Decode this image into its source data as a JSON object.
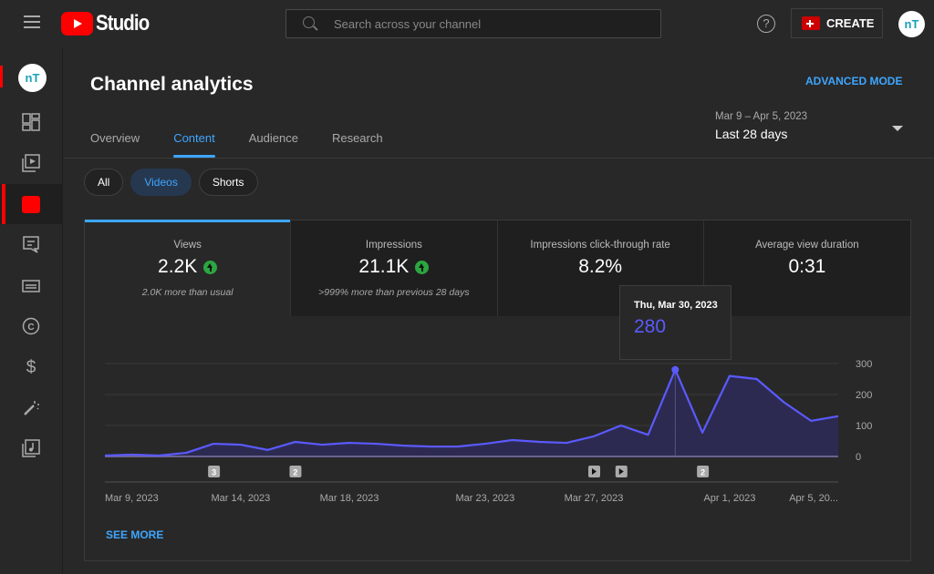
{
  "topbar": {
    "logo_text": "Studio",
    "search_placeholder": "Search across your channel",
    "help_label": "?",
    "create_label": "CREATE",
    "avatar_initials": "nT"
  },
  "sidebar": {
    "avatar_initials": "nT",
    "items": [
      {
        "name": "dashboard",
        "icon": "dashboard-icon"
      },
      {
        "name": "content",
        "icon": "content-icon"
      },
      {
        "name": "analytics",
        "icon": "analytics-icon",
        "active": true
      },
      {
        "name": "comments",
        "icon": "comments-icon"
      },
      {
        "name": "subtitles",
        "icon": "subtitles-icon"
      },
      {
        "name": "copyright",
        "icon": "copyright-icon"
      },
      {
        "name": "earn",
        "icon": "dollar-icon"
      },
      {
        "name": "customization",
        "icon": "magic-wand-icon"
      },
      {
        "name": "audio-library",
        "icon": "audio-library-icon"
      }
    ]
  },
  "main": {
    "title": "Channel analytics",
    "advanced_mode": "ADVANCED MODE",
    "tabs": [
      {
        "label": "Overview"
      },
      {
        "label": "Content",
        "active": true
      },
      {
        "label": "Audience"
      },
      {
        "label": "Research"
      }
    ],
    "date_range": {
      "sub": "Mar 9 – Apr 5, 2023",
      "main": "Last 28 days"
    },
    "chips": [
      {
        "label": "All"
      },
      {
        "label": "Videos",
        "active": true
      },
      {
        "label": "Shorts"
      }
    ],
    "metrics": [
      {
        "label": "Views",
        "value": "2.2K",
        "trend": "up",
        "sub": "2.0K more than usual"
      },
      {
        "label": "Impressions",
        "value": "21.1K",
        "trend": "up",
        "sub": ">999% more than previous 28 days"
      },
      {
        "label": "Impressions click-through rate",
        "value": "8.2%",
        "sub": ""
      },
      {
        "label": "Average view duration",
        "value": "0:31",
        "sub": ""
      }
    ],
    "tooltip": {
      "date": "Thu, Mar 30, 2023",
      "value": "280"
    },
    "see_more": "SEE MORE"
  },
  "colors": {
    "accent": "#3ea6ff",
    "line": "#5a5aff",
    "brand_red": "#ff0000",
    "trend_up": "#2ba640"
  },
  "chart_data": {
    "type": "area",
    "title": "Views",
    "x": [
      "Mar 9",
      "Mar 10",
      "Mar 11",
      "Mar 12",
      "Mar 13",
      "Mar 14",
      "Mar 15",
      "Mar 16",
      "Mar 17",
      "Mar 18",
      "Mar 19",
      "Mar 20",
      "Mar 21",
      "Mar 22",
      "Mar 23",
      "Mar 24",
      "Mar 25",
      "Mar 26",
      "Mar 27",
      "Mar 28",
      "Mar 29",
      "Mar 30",
      "Mar 31",
      "Apr 1",
      "Apr 2",
      "Apr 3",
      "Apr 4",
      "Apr 5"
    ],
    "series": [
      {
        "name": "Views",
        "values": [
          3,
          6,
          3,
          12,
          41,
          38,
          21,
          47,
          38,
          44,
          41,
          35,
          32,
          32,
          41,
          53,
          47,
          44,
          65,
          100,
          70,
          280,
          77,
          260,
          250,
          175,
          115,
          130
        ]
      }
    ],
    "x_tick_labels": [
      {
        "index": 0,
        "label": "Mar 9, 2023"
      },
      {
        "index": 5,
        "label": "Mar 14, 2023"
      },
      {
        "index": 9,
        "label": "Mar 18, 2023"
      },
      {
        "index": 14,
        "label": "Mar 23, 2023"
      },
      {
        "index": 18,
        "label": "Mar 27, 2023"
      },
      {
        "index": 23,
        "label": "Apr 1, 2023"
      },
      {
        "index": 27,
        "label": "Apr 5, 20..."
      }
    ],
    "y_ticks": [
      0,
      100,
      200,
      300
    ],
    "ylim": [
      0,
      300
    ],
    "y_axis_position": "right",
    "grid": true,
    "highlight_index": 21,
    "markers": [
      {
        "index": 4,
        "type": "count",
        "label": "3"
      },
      {
        "index": 7,
        "type": "count",
        "label": "2"
      },
      {
        "index": 18,
        "type": "video",
        "label": ""
      },
      {
        "index": 19,
        "type": "video",
        "label": ""
      },
      {
        "index": 22,
        "type": "count",
        "label": "2"
      }
    ]
  }
}
